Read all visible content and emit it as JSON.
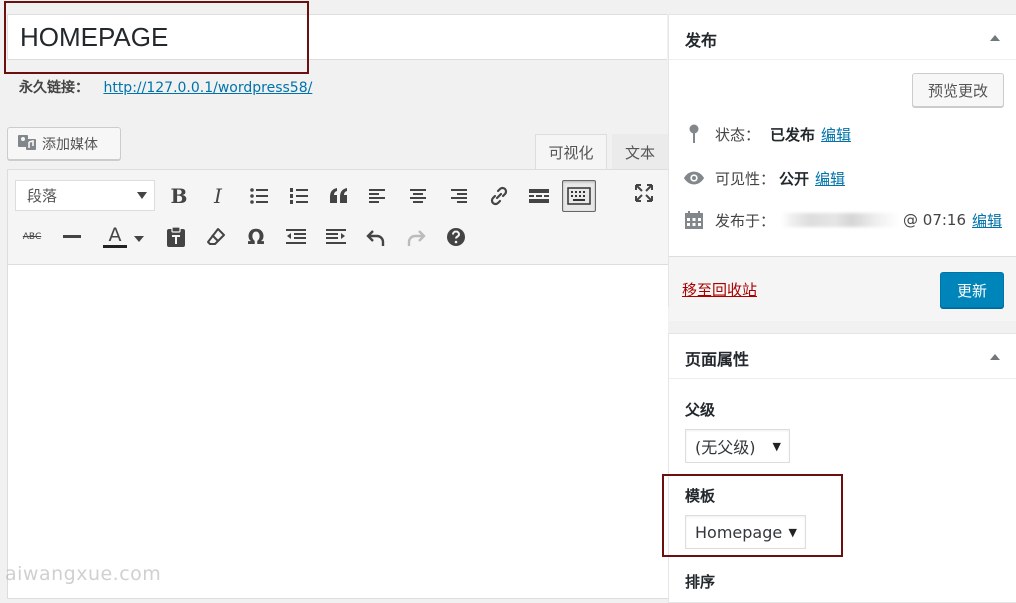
{
  "post": {
    "title": "HOMEPAGE",
    "permalink_label": "永久链接：",
    "permalink_url": "http://127.0.0.1/wordpress58/"
  },
  "editor": {
    "add_media_label": "添加媒体",
    "tabs": [
      {
        "label": "可视化",
        "active": true
      },
      {
        "label": "文本",
        "active": false
      }
    ],
    "format_select_value": "段落",
    "toolbar_row1_icons": [
      "bold-icon",
      "italic-icon",
      "bullet-list-icon",
      "numbered-list-icon",
      "blockquote-icon",
      "align-left-icon",
      "align-center-icon",
      "align-right-icon",
      "link-icon",
      "read-more-icon",
      "toolbar-toggle-icon",
      "fullscreen-icon"
    ],
    "toolbar_row2_icons": [
      "strikethrough-icon",
      "horizontal-line-icon",
      "text-color-icon",
      "paste-as-text-icon",
      "clear-formatting-icon",
      "special-character-icon",
      "outdent-icon",
      "indent-icon",
      "undo-icon",
      "redo-icon",
      "help-icon"
    ],
    "bold_glyph": "B",
    "italic_glyph": "I",
    "strike_glyph": "ABC",
    "text_color_glyph": "A",
    "omega_glyph": "Ω"
  },
  "publish": {
    "title": "发布",
    "preview_label": "预览更改",
    "status_label": "状态：",
    "status_value": "已发布",
    "visibility_label": "可见性：",
    "visibility_value": "公开",
    "published_label": "发布于：",
    "published_time": "@ 07:16",
    "edit_label": "编辑",
    "trash_label": "移至回收站",
    "update_label": "更新"
  },
  "page_attributes": {
    "title": "页面属性",
    "parent_label": "父级",
    "parent_value": "(无父级)",
    "template_label": "模板",
    "template_value": "Homepage",
    "order_label": "排序"
  },
  "watermark": "aiwangxue.com",
  "colors": {
    "accent": "#0085ba",
    "link": "#0073aa",
    "trash": "#a00000",
    "highlight_border": "#6b0f0f"
  }
}
